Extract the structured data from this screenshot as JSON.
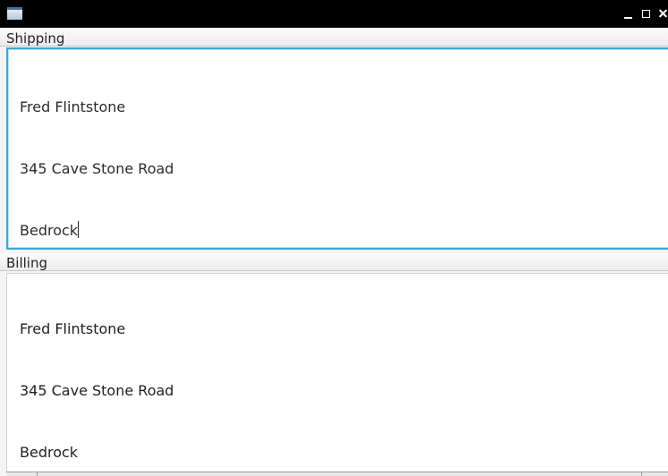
{
  "window": {
    "minimize_label": "",
    "maximize_label": "",
    "close_label": ""
  },
  "shipping": {
    "label": "Shipping",
    "lines": [
      "Fred Flintstone",
      "345 Cave Stone Road",
      "Bedrock"
    ]
  },
  "billing": {
    "label": "Billing",
    "lines": [
      "Fred Flintstone",
      "345 Cave Stone Road",
      "Bedrock"
    ]
  },
  "colors": {
    "titlebar": "#000000",
    "focus_border": "#3ea9d7"
  },
  "icons": {
    "app": "app-window-icon",
    "minimize": "minimize-icon",
    "maximize": "maximize-icon",
    "close": "close-icon"
  }
}
